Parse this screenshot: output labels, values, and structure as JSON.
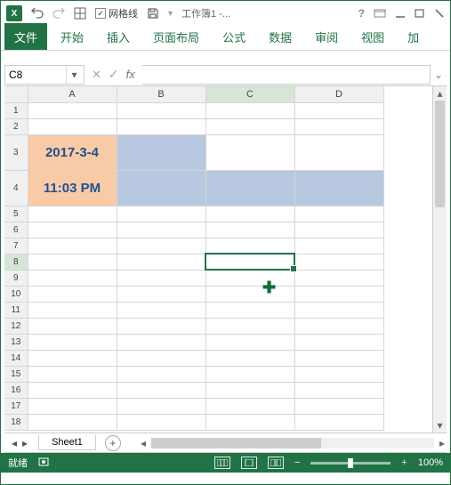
{
  "window": {
    "title": "工作簿1 -..."
  },
  "quickAccess": {
    "gridlines_label": "网格线"
  },
  "ribbon": {
    "file": "文件",
    "tabs": [
      "开始",
      "插入",
      "页面布局",
      "公式",
      "数据",
      "审阅",
      "视图",
      "加"
    ]
  },
  "formulaBar": {
    "nameBox": "C8",
    "fxLabel": "fx",
    "value": ""
  },
  "columns": [
    "A",
    "B",
    "C",
    "D"
  ],
  "rows": [
    "1",
    "2",
    "3",
    "4",
    "5",
    "6",
    "7",
    "8",
    "9",
    "10",
    "11",
    "12",
    "13",
    "14",
    "15",
    "16",
    "17",
    "18"
  ],
  "cells": {
    "A3": "2017-3-4",
    "A4": "11:03 PM"
  },
  "selection": {
    "col": "C",
    "row": "8"
  },
  "sheets": {
    "active": "Sheet1",
    "add_label": "+"
  },
  "status": {
    "ready": "就绪",
    "zoom": "100%",
    "minus": "−",
    "plus": "+"
  }
}
